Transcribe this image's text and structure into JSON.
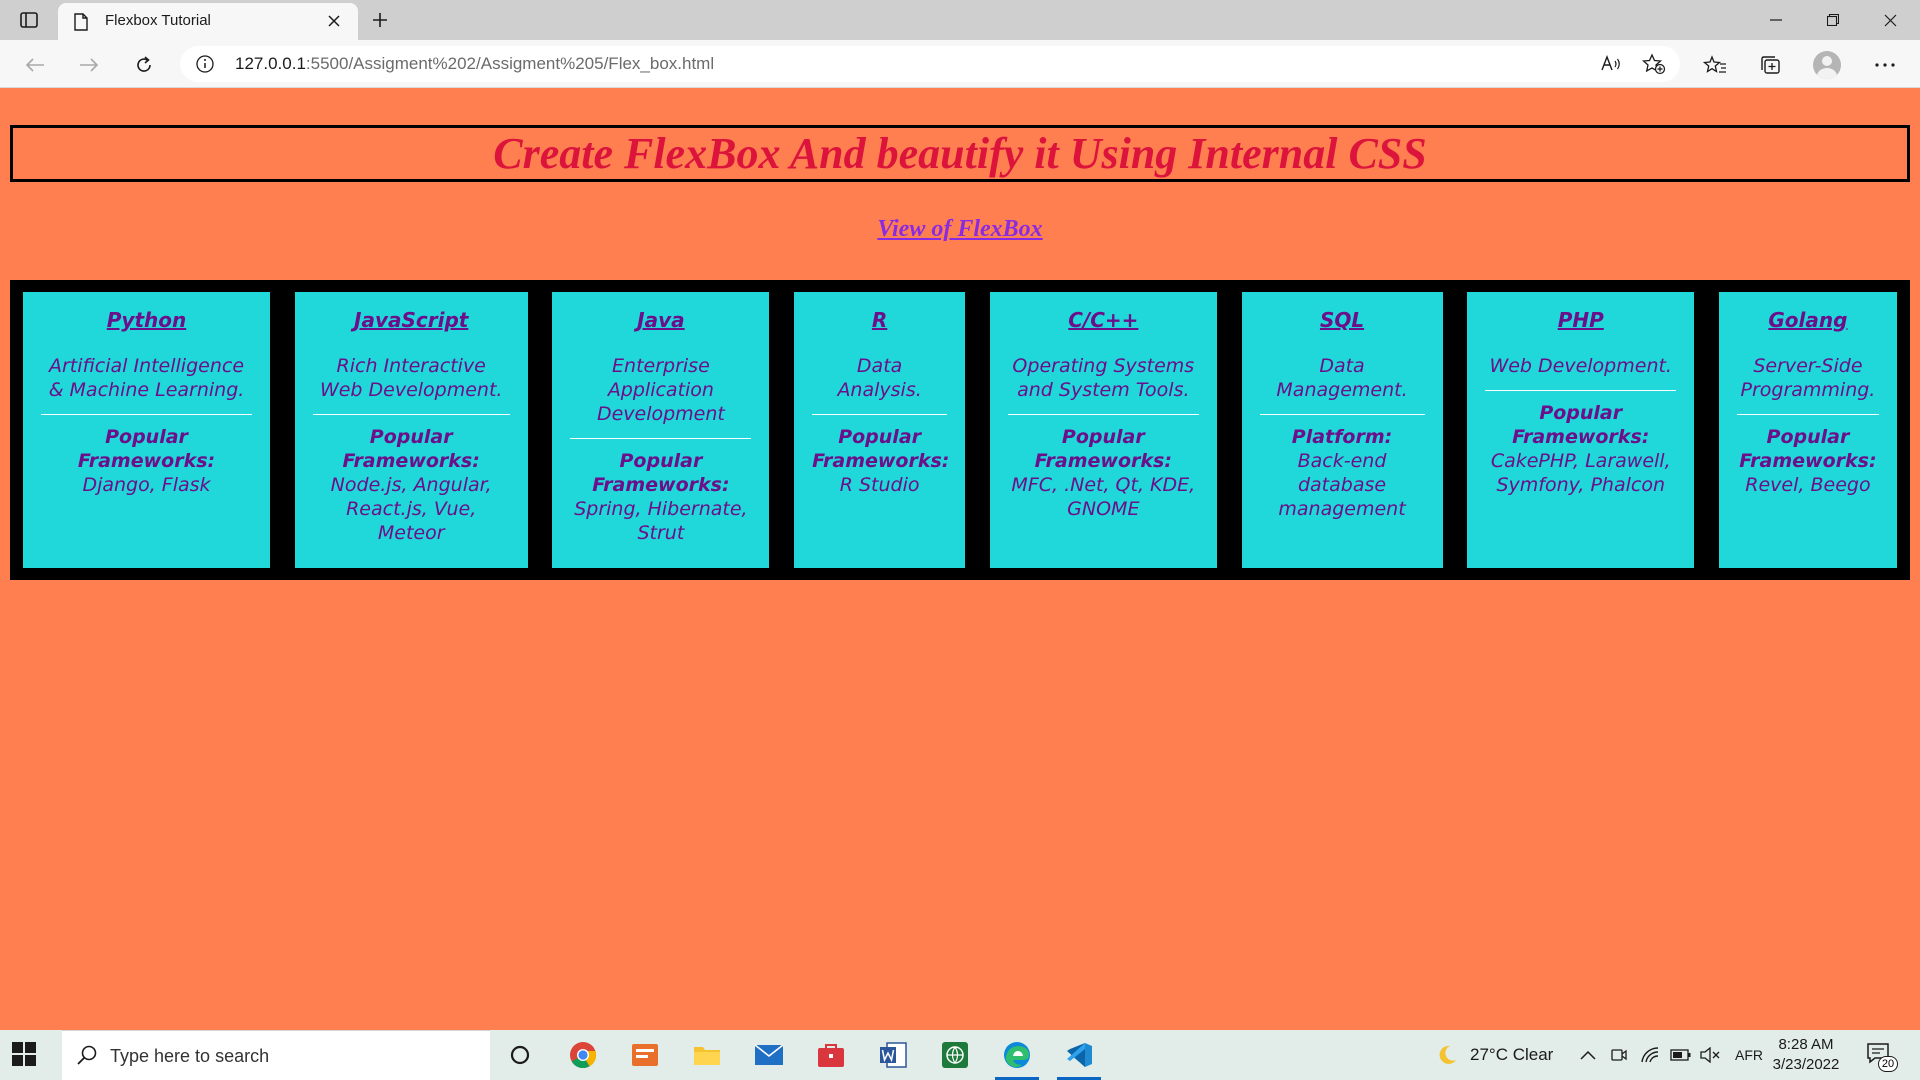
{
  "browser": {
    "tab_title": "Flexbox Tutorial",
    "url_host": "127.0.0.1",
    "url_rest": ":5500/Assigment%202/Assigment%205/Flex_box.html"
  },
  "page": {
    "heading": "Create FlexBox And beautify it Using Internal CSS",
    "link": "View of FlexBox",
    "cards": [
      {
        "lang": "Python",
        "desc": "Artificial Intelligence & Machine Learning.",
        "fw_label": "Popular Frameworks:",
        "fw": "Django, Flask"
      },
      {
        "lang": "JavaScript",
        "desc": "Rich Interactive Web Development.",
        "fw_label": "Popular Frameworks:",
        "fw": "Node.js, Angular, React.js, Vue, Meteor"
      },
      {
        "lang": "Java",
        "desc": "Enterprise Application Development",
        "fw_label": "Popular Frameworks:",
        "fw": "Spring, Hibernate, Strut"
      },
      {
        "lang": "R",
        "desc": "Data Analysis.",
        "fw_label": "Popular Frameworks:",
        "fw": "R Studio"
      },
      {
        "lang": "C/C++",
        "desc": "Operating Systems and System Tools.",
        "fw_label": "Popular Frameworks:",
        "fw": "MFC, .Net, Qt, KDE, GNOME"
      },
      {
        "lang": "SQL",
        "desc": "Data Management.",
        "fw_label": "Platform:",
        "fw": "Back-end database management"
      },
      {
        "lang": "PHP",
        "desc": "Web Development.",
        "fw_label": "Popular Frameworks:",
        "fw": "CakePHP, Larawell, Symfony, Phalcon"
      },
      {
        "lang": "Golang",
        "desc": "Server-Side Programming.",
        "fw_label": "Popular Frameworks:",
        "fw": "Revel, Beego"
      }
    ]
  },
  "taskbar": {
    "search_placeholder": "Type here to search",
    "weather": "27°C  Clear",
    "language": "AFR",
    "time": "8:28 AM",
    "date": "3/23/2022",
    "notifications": "20"
  },
  "colors": {
    "page_bg": "#ff7f50",
    "heading": "#dc143c",
    "link": "#8a2be2",
    "card_bg": "#20d7d9",
    "card_text": "#6b0f8a"
  }
}
